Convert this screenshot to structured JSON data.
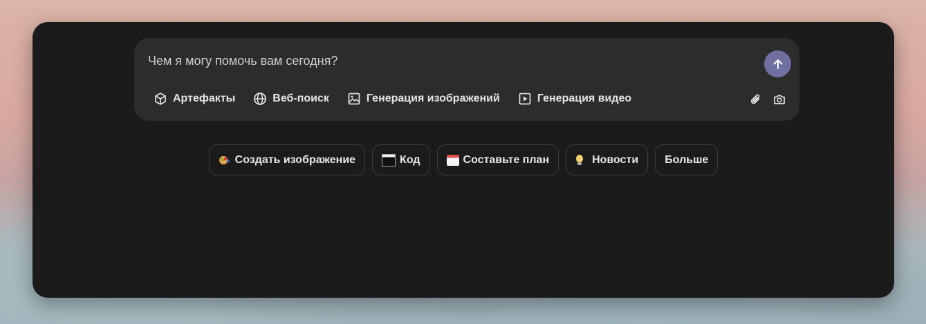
{
  "composer": {
    "placeholder": "Чем я могу помочь вам сегодня?",
    "send_icon": "arrow-up-icon",
    "tools": [
      {
        "label": "Артефакты",
        "icon": "cube-icon"
      },
      {
        "label": "Веб-поиск",
        "icon": "globe-icon"
      },
      {
        "label": "Генерация изображений",
        "icon": "image-icon"
      },
      {
        "label": "Генерация видео",
        "icon": "video-play-icon"
      }
    ],
    "attach_icon": "paperclip-icon",
    "camera_icon": "camera-icon"
  },
  "suggestions": [
    {
      "label": "Создать изображение",
      "icon": "palette-emoji"
    },
    {
      "label": "Код",
      "icon": "terminal-emoji"
    },
    {
      "label": "Составьте план",
      "icon": "calendar-emoji"
    },
    {
      "label": "Новости",
      "icon": "lightbulb-emoji"
    },
    {
      "label": "Больше",
      "icon": ""
    }
  ],
  "colors": {
    "panel": "#1b1b1b",
    "composer": "#2c2c2c",
    "send_button": "#6f6fa0",
    "text": "#e4e4e4"
  }
}
